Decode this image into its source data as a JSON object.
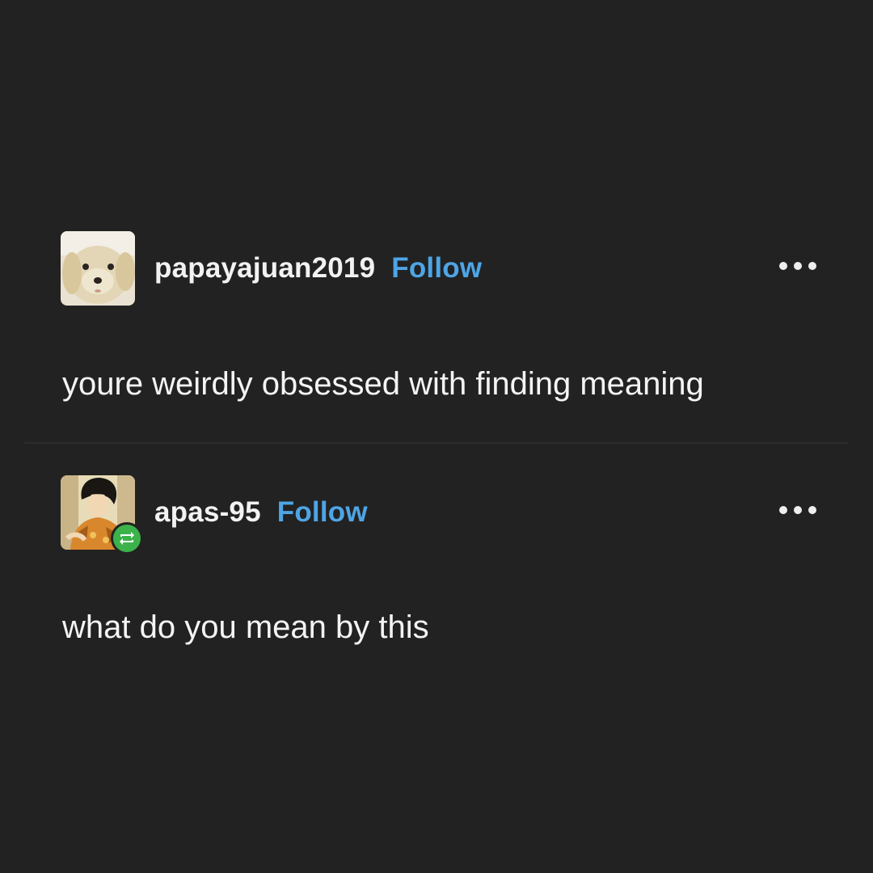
{
  "posts": [
    {
      "username": "papayajuan2019",
      "follow_label": "Follow",
      "avatar_icon": "dog-plush-avatar",
      "more_icon": "more-dots-icon",
      "body": "youre weirdly obsessed with finding meaning"
    },
    {
      "username": "apas-95",
      "follow_label": "Follow",
      "avatar_icon": "anime-character-avatar",
      "badge_icon": "reblog-icon",
      "more_icon": "more-dots-icon",
      "body": "what do you mean by this"
    }
  ],
  "colors": {
    "background": "#222222",
    "text": "#f2f2f2",
    "follow": "#4ea5e6",
    "reblog_badge": "#3bb34a"
  }
}
